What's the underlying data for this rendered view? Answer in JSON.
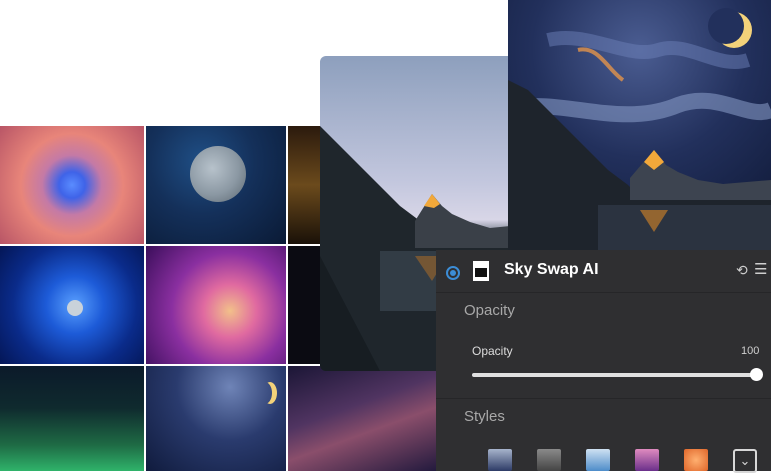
{
  "panel": {
    "title": "Sky Swap AI",
    "sections": {
      "opacity_header": "Opacity",
      "opacity_label": "Opacity",
      "opacity_value": "100",
      "styles_header": "Styles"
    },
    "slider_level": 1.0,
    "icons": {
      "toggle": "radio-icon",
      "filter": "filter-icon",
      "reset": "reset-icon",
      "menu": "menu-icon",
      "expand": "chevron-down-icon"
    }
  },
  "sky_thumbnails": [
    "nebula",
    "full-moon",
    "dusk",
    "blue-moon",
    "purple-clouds",
    "stars",
    "aurora",
    "crescent-moon",
    "milky-way"
  ],
  "colors": {
    "accent": "#3c8dd6",
    "panel_bg": "#2f2f31",
    "panel_text": "#e6e6e6"
  }
}
